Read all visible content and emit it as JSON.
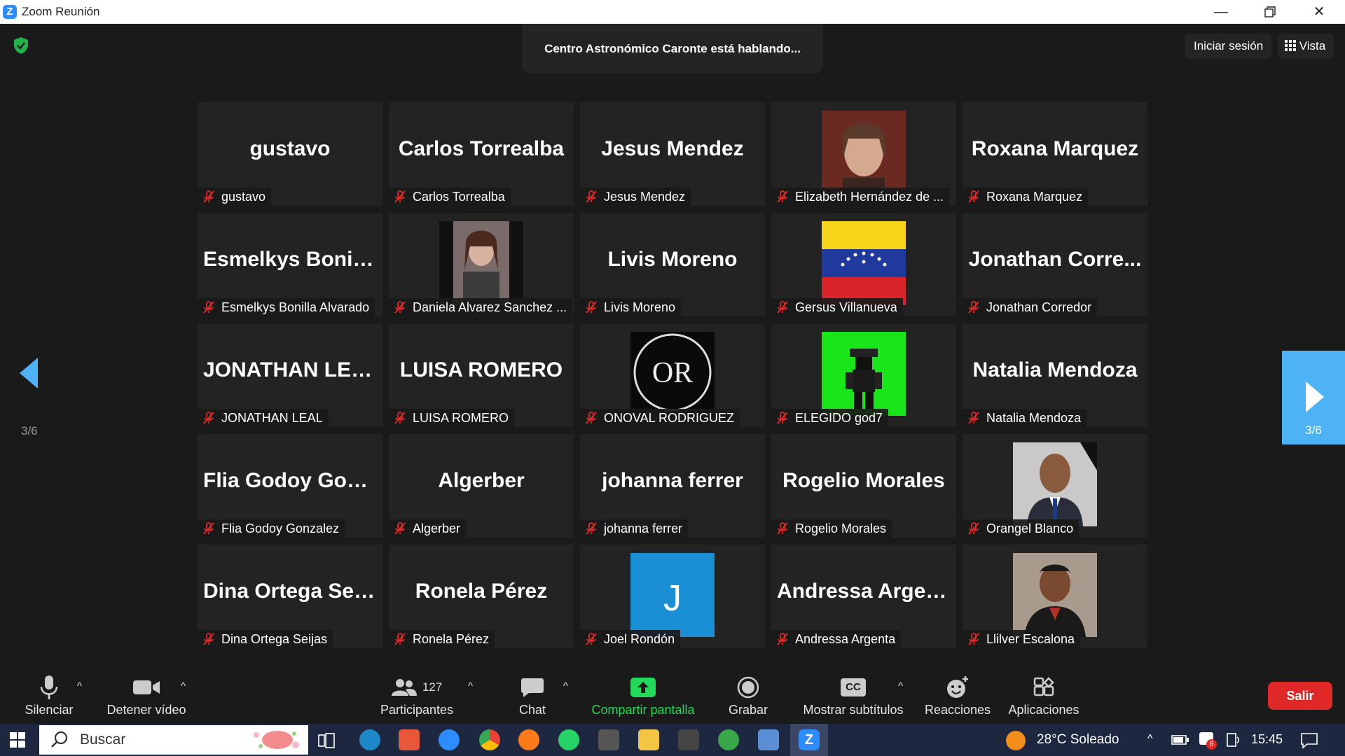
{
  "window": {
    "title": "Zoom Reunión"
  },
  "header": {
    "speaking": "Centro Astronómico Caronte está hablando...",
    "signin": "Iniciar sesión",
    "view": "Vista"
  },
  "pagination": {
    "left": "3/6",
    "right": "3/6"
  },
  "tiles": [
    {
      "big": "gustavo",
      "label": "gustavo"
    },
    {
      "big": "Carlos Torrealba",
      "label": "Carlos Torrealba"
    },
    {
      "big": "Jesus Mendez",
      "label": "Jesus Mendez"
    },
    {
      "big": "",
      "label": "Elizabeth Hernández de ..."
    },
    {
      "big": "Roxana Marquez",
      "label": "Roxana Marquez"
    },
    {
      "big": "Esmelkys  Bonill...",
      "label": "Esmelkys Bonilla Alvarado"
    },
    {
      "big": "",
      "label": "Daniela Alvarez Sanchez ..."
    },
    {
      "big": "Livis Moreno",
      "label": "Livis Moreno"
    },
    {
      "big": "",
      "label": "Gersus Villanueva"
    },
    {
      "big": "Jonathan  Corre...",
      "label": "Jonathan Corredor"
    },
    {
      "big": "JONATHAN LEAL",
      "label": "JONATHAN LEAL"
    },
    {
      "big": "LUISA ROMERO",
      "label": "LUISA ROMERO"
    },
    {
      "big": "",
      "label": "ONOVAL RODRIGUEZ"
    },
    {
      "big": "",
      "label": "ELEGIDO god7"
    },
    {
      "big": "Natalia Mendoza",
      "label": "Natalia Mendoza"
    },
    {
      "big": "Flia  Godoy  Gon...",
      "label": "Flia Godoy Gonzalez"
    },
    {
      "big": "Algerber",
      "label": "Algerber"
    },
    {
      "big": "johanna ferrer",
      "label": "johanna ferrer"
    },
    {
      "big": "Rogelio Morales",
      "label": "Rogelio Morales"
    },
    {
      "big": "",
      "label": "Orangel Blanco"
    },
    {
      "big": "Dina  Ortega  Sei...",
      "label": "Dina Ortega Seijas"
    },
    {
      "big": "Ronela Pérez",
      "label": "Ronela Pérez"
    },
    {
      "big": "",
      "label": "Joel Rondón"
    },
    {
      "big": "Andressa Argenta",
      "label": "Andressa Argenta"
    },
    {
      "big": "",
      "label": "Llilver Escalona"
    }
  ],
  "avatars": {
    "onoval_initials": "OR",
    "joel_initial": "J"
  },
  "toolbar": {
    "mute": "Silenciar",
    "video": "Detener vídeo",
    "participants": "Participantes",
    "participants_count": "127",
    "chat": "Chat",
    "share": "Compartir pantalla",
    "record": "Grabar",
    "subtitles": "Mostrar subtítulos",
    "cc": "CC",
    "reactions": "Reacciones",
    "apps": "Aplicaciones",
    "leave": "Salir"
  },
  "taskbar": {
    "search": "Buscar",
    "weather": "28°C  Soleado",
    "time": "15:45",
    "badge": "8"
  },
  "colors": {
    "accent": "#2d8cff",
    "share_green": "#23d959",
    "leave_red": "#e02828",
    "nav_blue": "#4db3f5",
    "muted_red": "#e02828"
  }
}
